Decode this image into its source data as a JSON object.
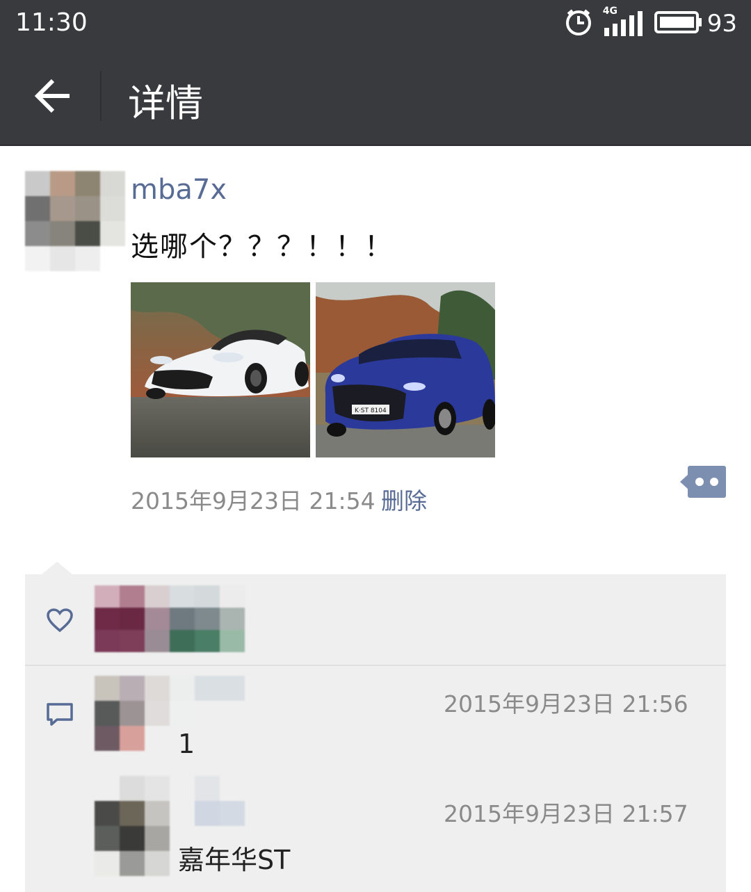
{
  "status_bar": {
    "time": "11:30",
    "network": "4G",
    "battery": "93",
    "icons": [
      "alarm-icon",
      "signal-icon",
      "battery-icon"
    ]
  },
  "nav": {
    "title": "详情",
    "back_icon": "back-arrow-icon"
  },
  "post": {
    "author": "mba7x",
    "text": "选哪个？？？！！！",
    "images": [
      "white-convertible-car-photo",
      "blue-hatchback-car-photo"
    ],
    "time": "2015年9月23日 21:54",
    "delete_label": "删除",
    "more_icon": "more-dots-icon"
  },
  "likes": {
    "icon": "heart-icon"
  },
  "comments": {
    "icon": "comment-icon",
    "items": [
      {
        "time": "2015年9月23日 21:56",
        "text": "1"
      },
      {
        "time": "2015年9月23日 21:57",
        "text": "嘉年华ST"
      }
    ]
  },
  "colors": {
    "header_bg": "#393a3e",
    "link": "#576b95",
    "panel_bg": "#efefef",
    "meta_text": "#8a8a8a"
  }
}
